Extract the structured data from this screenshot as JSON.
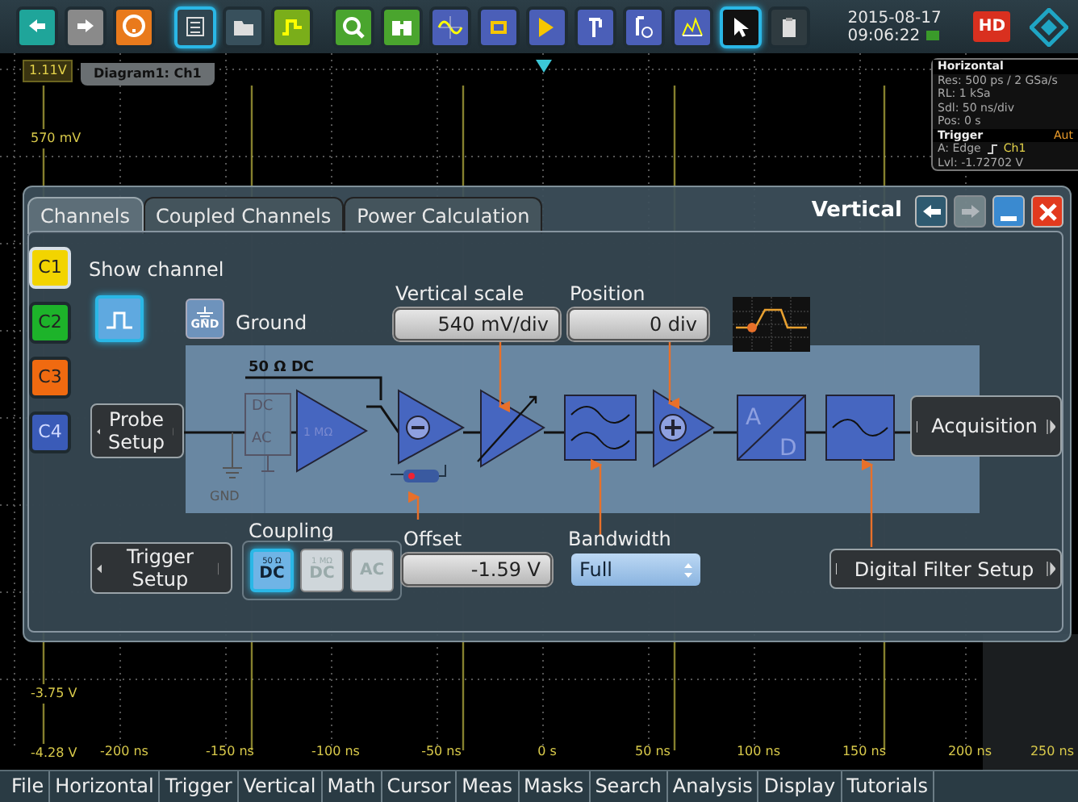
{
  "toolbar": {
    "buttons": [
      {
        "kind": "undo",
        "selected": false
      },
      {
        "kind": "redo",
        "selected": false
      },
      {
        "kind": "help",
        "selected": false
      },
      {
        "kind": "list",
        "selected": true
      },
      {
        "kind": "open",
        "selected": false
      },
      {
        "kind": "autoset",
        "selected": false
      },
      {
        "kind": "zoom",
        "selected": false
      },
      {
        "kind": "find",
        "selected": false
      },
      {
        "kind": "wave",
        "selected": false
      },
      {
        "kind": "chip",
        "selected": false
      },
      {
        "kind": "flag",
        "selected": false
      },
      {
        "kind": "cursor",
        "selected": false
      },
      {
        "kind": "timer",
        "selected": false
      },
      {
        "kind": "spectrum",
        "selected": false
      },
      {
        "kind": "pointer",
        "selected": true
      },
      {
        "kind": "clipboard",
        "selected": false
      }
    ],
    "date": "2015-08-17",
    "time": "09:06:22",
    "hd_badge": "HD"
  },
  "diagram": {
    "tab": "Diagram1: Ch1",
    "y_labels": [
      {
        "text": "1.11V",
        "kind": "top"
      },
      {
        "text": "570 mV",
        "kind": "plain"
      },
      {
        "text": "-3.75 V",
        "kind": "plain"
      },
      {
        "text": "-4.28 V",
        "kind": "plain"
      }
    ],
    "x_labels": [
      "-200 ns",
      "-150 ns",
      "-100 ns",
      "-50 ns",
      "0 s",
      "50 ns",
      "100 ns",
      "150 ns",
      "200 ns",
      "250 ns"
    ]
  },
  "info": {
    "horizontal": {
      "title": "Horizontal",
      "lines": [
        "Res: 500 ps / 2 GSa/s",
        "RL: 1 kSa",
        "Sdl: 50 ns/div",
        "Pos: 0 s"
      ]
    },
    "trigger": {
      "title": "Trigger",
      "mode": "Aut",
      "type": "A: Edge",
      "source": "Ch1",
      "lvl": "Lvl: -1.72702 V"
    }
  },
  "dialog": {
    "title": "Vertical",
    "window_buttons": [
      {
        "kind": "undo",
        "disabled": false
      },
      {
        "kind": "redo",
        "disabled": true
      },
      {
        "kind": "minimize",
        "disabled": false
      },
      {
        "kind": "close",
        "disabled": false
      }
    ],
    "tabs": [
      {
        "label": "Channels",
        "selected": true
      },
      {
        "label": "Coupled Channels",
        "selected": false
      },
      {
        "label": "Power Calculation",
        "selected": false
      }
    ],
    "channels": [
      {
        "label": "C1",
        "color": "#f2d400",
        "selected": true
      },
      {
        "label": "C2",
        "color": "#1db32a",
        "selected": false
      },
      {
        "label": "C3",
        "color": "#f06a10",
        "selected": false
      },
      {
        "label": "C4",
        "color": "#3a5bb8",
        "selected": false
      }
    ],
    "show_channel": {
      "label": "Show channel",
      "on": true
    },
    "ground": {
      "button": "GND",
      "label": "Ground"
    },
    "vertical_scale": {
      "label": "Vertical scale",
      "value": "540 mV/div"
    },
    "position": {
      "label": "Position",
      "value": "0 div"
    },
    "diagram_texts": {
      "termination": "50 Ω DC",
      "dc": "DC",
      "ac": "AC",
      "impedance": "1 MΩ",
      "gnd": "GND",
      "a": "A",
      "d": "D"
    },
    "probe_setup": "Probe Setup",
    "acquisition": "Acquisition",
    "trigger_setup": "Trigger Setup",
    "coupling": {
      "label": "Coupling",
      "options": [
        {
          "top": "50 Ω",
          "main": "DC",
          "selected": true
        },
        {
          "top": "1 MΩ",
          "main": "DC",
          "selected": false
        },
        {
          "main": "AC",
          "selected": false
        }
      ]
    },
    "offset": {
      "label": "Offset",
      "value": "-1.59 V"
    },
    "bandwidth": {
      "label": "Bandwidth",
      "value": "Full"
    },
    "digital_filter": "Digital Filter Setup"
  },
  "menu": [
    "File",
    "Horizontal",
    "Trigger",
    "Vertical",
    "Math",
    "Cursor",
    "Meas",
    "Masks",
    "Search",
    "Analysis",
    "Display",
    "Tutorials"
  ]
}
